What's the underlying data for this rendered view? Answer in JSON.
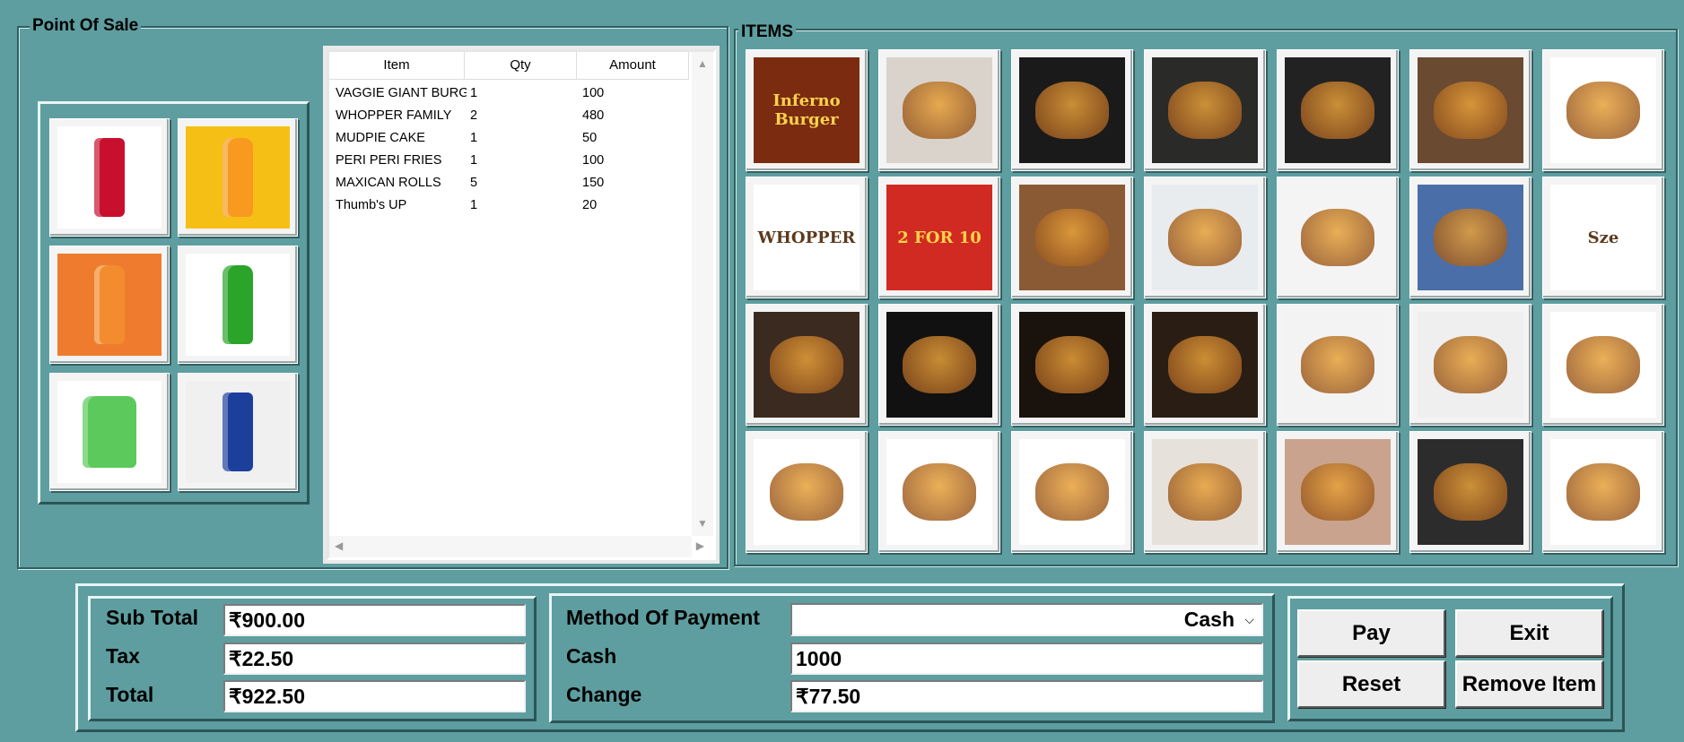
{
  "window": {
    "section_title": "Point Of Sale",
    "items_title": "ITEMS"
  },
  "drinks": [
    {
      "name": "coca-cola-can",
      "bg": "#ffffff"
    },
    {
      "name": "mango-juice-bottle",
      "bg": "#f6bf16"
    },
    {
      "name": "orange-juice-bottle",
      "bg": "#ef7c2e"
    },
    {
      "name": "green-soda-bottle",
      "bg": "#ffffff"
    },
    {
      "name": "green-mojito-glass",
      "bg": "#ffffff"
    },
    {
      "name": "blue-energy-can",
      "bg": "#f0f0f0"
    }
  ],
  "order": {
    "headers": {
      "item": "Item",
      "qty": "Qty",
      "amount": "Amount"
    },
    "rows": [
      {
        "item": "VAGGIE GIANT BURGI",
        "qty": "1",
        "amount": "100"
      },
      {
        "item": "WHOPPER FAMILY",
        "qty": "2",
        "amount": "480"
      },
      {
        "item": "MUDPIE CAKE",
        "qty": "1",
        "amount": "50"
      },
      {
        "item": "PERI PERI FRIES",
        "qty": "1",
        "amount": "100"
      },
      {
        "item": "MAXICAN ROLLS",
        "qty": "5",
        "amount": "150"
      },
      {
        "item": "Thumb's UP",
        "qty": "1",
        "amount": "20"
      }
    ]
  },
  "menu_items": [
    {
      "name": "inferno-burger-image",
      "text": "Inferno Burger",
      "bg": "#7a2b10"
    },
    {
      "name": "burger-image",
      "bg": "#d9d3cc"
    },
    {
      "name": "double-burger-image",
      "bg": "#1a1a1a"
    },
    {
      "name": "egg-burger-image",
      "bg": "#2a2a28"
    },
    {
      "name": "burger-fries-image",
      "bg": "#222222"
    },
    {
      "name": "steak-burger-image",
      "bg": "#6a4a30"
    },
    {
      "name": "snack-bar-image",
      "bg": "#ffffff"
    },
    {
      "name": "whopper-image",
      "text": "WHOPPER",
      "bg": "#ffffff"
    },
    {
      "name": "whopper-meal-image",
      "text": "2 FOR 10",
      "bg": "#d12a22"
    },
    {
      "name": "spring-rolls-plate-image",
      "bg": "#8a5a35"
    },
    {
      "name": "french-fries-bowl-image",
      "bg": "#e9ecef"
    },
    {
      "name": "croquettes-image",
      "bg": "#f4f4f4"
    },
    {
      "name": "peri-peri-fries-image",
      "bg": "#4a6ea8"
    },
    {
      "name": "sauce-pack-image",
      "text": "Sze",
      "bg": "#ffffff"
    },
    {
      "name": "coffee-cup-image",
      "bg": "#3b2a1f"
    },
    {
      "name": "frappe-image",
      "bg": "#111111"
    },
    {
      "name": "espresso-image",
      "bg": "#1a120c"
    },
    {
      "name": "cold-coffee-image",
      "bg": "#2a1d14"
    },
    {
      "name": "mudpie-cake-image",
      "bg": "#f3f3f3"
    },
    {
      "name": "cappuccino-image",
      "bg": "#efefef"
    },
    {
      "name": "ice-cream-cone-image",
      "bg": "#ffffff"
    },
    {
      "name": "samosa-image",
      "bg": "#ffffff"
    },
    {
      "name": "chilli-pasta-image",
      "bg": "#ffffff"
    },
    {
      "name": "mexican-rolls-image",
      "bg": "#ffffff"
    },
    {
      "name": "noodles-image",
      "bg": "#e6e1da"
    },
    {
      "name": "manchurian-image",
      "bg": "#c9a38e"
    },
    {
      "name": "tacos-image",
      "bg": "#2c2c2c"
    },
    {
      "name": "choco-cone-image",
      "bg": "#ffffff"
    }
  ],
  "totals": {
    "subtotal_label": "Sub Total",
    "subtotal_value": "₹900.00",
    "tax_label": "Tax",
    "tax_value": "₹22.50",
    "total_label": "Total",
    "total_value": "₹922.50"
  },
  "payment": {
    "method_label": "Method Of Payment",
    "method_value": "Cash",
    "cash_label": "Cash",
    "cash_value": "1000",
    "change_label": "Change",
    "change_value": "₹77.50"
  },
  "buttons": {
    "pay": "Pay",
    "exit": "Exit",
    "reset": "Reset",
    "remove": "Remove Item"
  }
}
